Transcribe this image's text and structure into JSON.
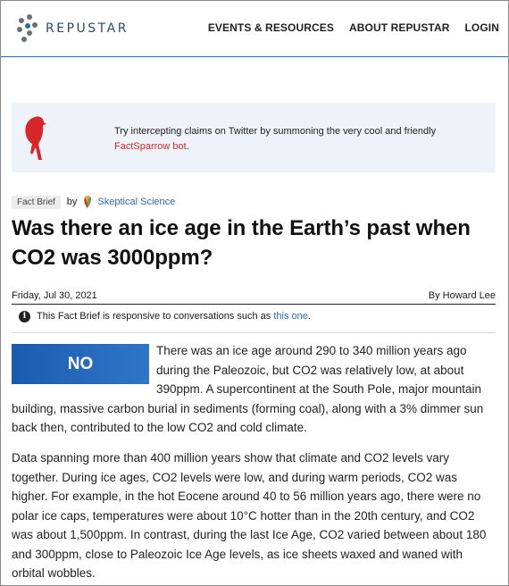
{
  "header": {
    "brand": "REPUSTAR",
    "nav": [
      "EVENTS & RESOURCES",
      "ABOUT REPUSTAR",
      "LOGIN"
    ]
  },
  "banner": {
    "text": "Try intercepting claims on Twitter by summoning the very cool and friendly",
    "link": "FactSparrow bot",
    "tail": "."
  },
  "article": {
    "tag": "Fact Brief",
    "by": "by",
    "source": "Skeptical Science",
    "title": "Was there an ice age in the Earth’s past when CO2 was 3000ppm?",
    "date": "Friday, Jul 30, 2021",
    "author": "By Howard Lee",
    "info_prefix": "This Fact Brief is responsive to conversations such as",
    "info_link": "this one",
    "info_suffix": ".",
    "verdict": "NO",
    "p1": "There was an ice age around 290 to 340 million years ago during the Paleozoic, but CO2 was relatively low, at about 390ppm. A supercontinent at the South Pole, major mountain building, massive carbon burial in sediments (forming coal), along with a 3% dimmer sun back then, contributed to the low CO2 and cold climate.",
    "p2": "Data spanning more than 400 million years show that climate and CO2 levels vary together. During ice ages, CO2 levels were low, and during warm periods, CO2 was higher. For example, in the hot Eocene around 40 to 56 million years ago, there were no polar ice caps, temperatures were about 10°C hotter than in the 20th century, and CO2 was about 1,500ppm. In contrast, during the last Ice Age, CO2 varied between about 180 and 300ppm, close to Paleozoic Ice Age levels, as ice sheets waxed and waned with orbital wobbles."
  },
  "colors": {
    "accent": "#2b6cb0",
    "bird": "#d9262b",
    "verdict": "#1a5bb0"
  }
}
